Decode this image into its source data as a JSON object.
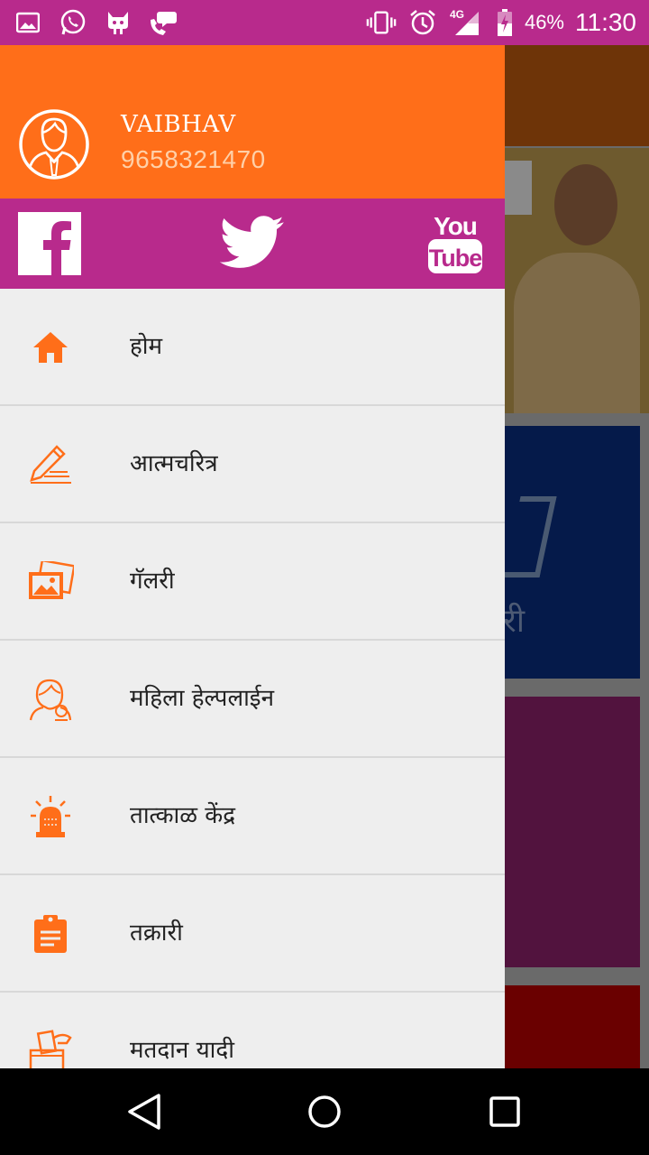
{
  "status_bar": {
    "battery_percent": "46%",
    "time": "11:30",
    "network": "4G",
    "icons": [
      "image-icon",
      "whatsapp-icon",
      "cat-app-icon",
      "phone-chat-icon",
      "vibrate-icon",
      "alarm-icon",
      "signal-icon",
      "battery-icon"
    ]
  },
  "drawer": {
    "user": {
      "name": "VAIBHAV",
      "phone": "9658321470"
    },
    "social": [
      "facebook-icon",
      "twitter-icon",
      "youtube-icon"
    ],
    "menu_items": [
      {
        "label": "होम",
        "icon": "home-icon"
      },
      {
        "label": "आत्मचरित्र",
        "icon": "pencil-write-icon"
      },
      {
        "label": "गॅलरी",
        "icon": "gallery-icon"
      },
      {
        "label": "महिला हेल्पलाईन",
        "icon": "woman-helpline-icon"
      },
      {
        "label": "तात्काळ केंद्र",
        "icon": "siren-icon"
      },
      {
        "label": "तक्रारी",
        "icon": "clipboard-icon"
      },
      {
        "label": "मतदान यादी",
        "icon": "ballot-box-icon"
      }
    ]
  },
  "background": {
    "tile_text": "री"
  },
  "colors": {
    "accent_orange": "#ff6e19",
    "accent_magenta": "#b82a8c"
  },
  "nav_bar": [
    "back-icon",
    "home-circle-icon",
    "recents-icon"
  ]
}
